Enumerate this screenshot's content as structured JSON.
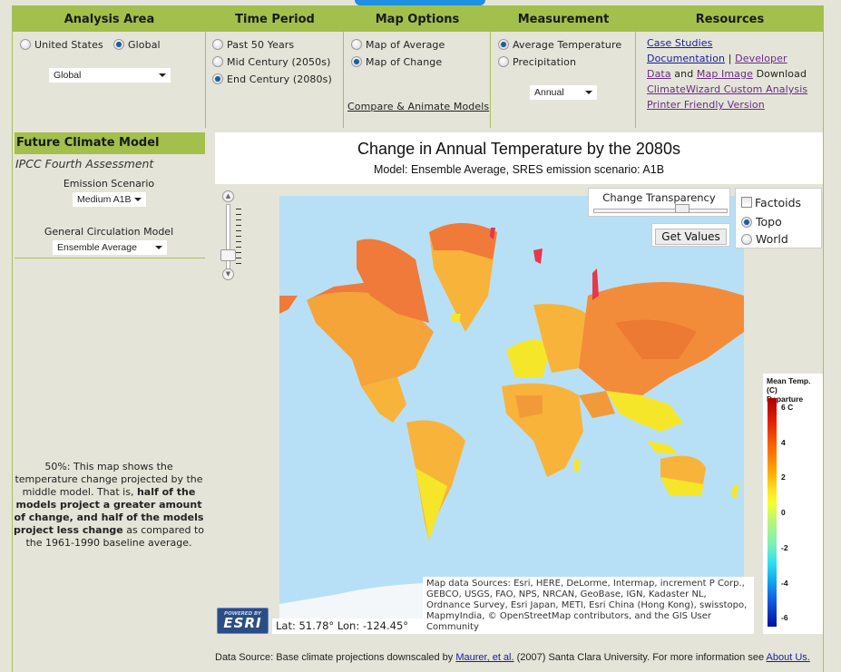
{
  "header": {
    "analysis_area": "Analysis Area",
    "time_period": "Time Period",
    "map_options": "Map Options",
    "measurement": "Measurement",
    "resources": "Resources"
  },
  "analysis_area": {
    "options": [
      {
        "label": "United States",
        "selected": false
      },
      {
        "label": "Global",
        "selected": true
      }
    ],
    "region_select": "Global"
  },
  "time_period": {
    "options": [
      {
        "label": "Past 50 Years",
        "selected": false
      },
      {
        "label": "Mid Century (2050s)",
        "selected": false
      },
      {
        "label": "End Century (2080s)",
        "selected": true
      }
    ]
  },
  "map_options": {
    "options": [
      {
        "label": "Map of Average",
        "selected": false
      },
      {
        "label": "Map of Change",
        "selected": true
      }
    ],
    "compare_link": "Compare & Animate Models"
  },
  "measurement": {
    "options": [
      {
        "label": "Average Temperature",
        "selected": true
      },
      {
        "label": "Precipitation",
        "selected": false
      }
    ],
    "season_select": "Annual"
  },
  "resources": {
    "case_studies": "Case Studies",
    "documentation": "Documentation",
    "separator": "|",
    "developer": "Developer",
    "data": "Data",
    "and": "and",
    "map_image": "Map Image",
    "download": "Download",
    "custom_analysis": "ClimateWizard Custom Analysis",
    "printer_friendly": "Printer Friendly Version"
  },
  "sidebar": {
    "title": "Future Climate Model",
    "subtitle": "IPCC Fourth Assessment",
    "emission_label": "Emission Scenario",
    "emission_select": "Medium A1B",
    "gcm_label": "General Circulation Model",
    "gcm_select": "Ensemble Average",
    "desc_intro": "50%: This map shows the temperature change projected by the middle model. That is, ",
    "desc_bold": "half of the models project a greater amount of change, and half of the models project less change",
    "desc_outro": " as compared to the 1961-1990 baseline average."
  },
  "map": {
    "title": "Change in Annual Temperature by the 2080s",
    "subtitle": "Model: Ensemble Average, SRES emission scenario: A1B",
    "transparency_label": "Change Transparency",
    "transparency_value": 0.68,
    "get_values": "Get Values",
    "layers": [
      {
        "label": "Factoids",
        "type": "checkbox",
        "checked": false
      },
      {
        "label": "Topo",
        "type": "radio",
        "checked": true
      },
      {
        "label": "World",
        "type": "radio",
        "checked": false
      }
    ],
    "zoom_level_fraction": 0.1,
    "coords": "Lat: 51.78° Lon: -124.45°",
    "attribution": "Map data Sources: Esri, HERE, DeLorme, Intermap, increment P Corp., GEBCO, USGS, FAO, NPS, NRCAN, GeoBase, IGN, Kadaster NL, Ordnance Survey, Esri Japan, METI, Esri China (Hong Kong), swisstopo, MapmyIndia, © OpenStreetMap contributors, and the GIS User Community",
    "esri_powered": "POWERED BY",
    "esri_name": "ESRI"
  },
  "legend": {
    "title_line1": "Mean Temp. (C)",
    "title_line2": "Departure",
    "ticks": [
      "6 C",
      "4",
      "2",
      "0",
      "-2",
      "-4",
      "-6"
    ]
  },
  "footer": {
    "prefix": "Data Source: Base climate projections downscaled by ",
    "maurer_link": "Maurer, et al.",
    "middle": " (2007) Santa Clara University. For more information see ",
    "about_link": "About Us."
  },
  "colors": {
    "header_green": "#a2c04b",
    "page_bg": "#e4e5d8",
    "link_blue": "#1a1aa6",
    "link_visited": "#6a2a8a",
    "ocean": "#b7e0f7",
    "warm_orange": "#f28c3a",
    "warm_yellow": "#f6e62a",
    "hot_red": "#e8374a"
  }
}
